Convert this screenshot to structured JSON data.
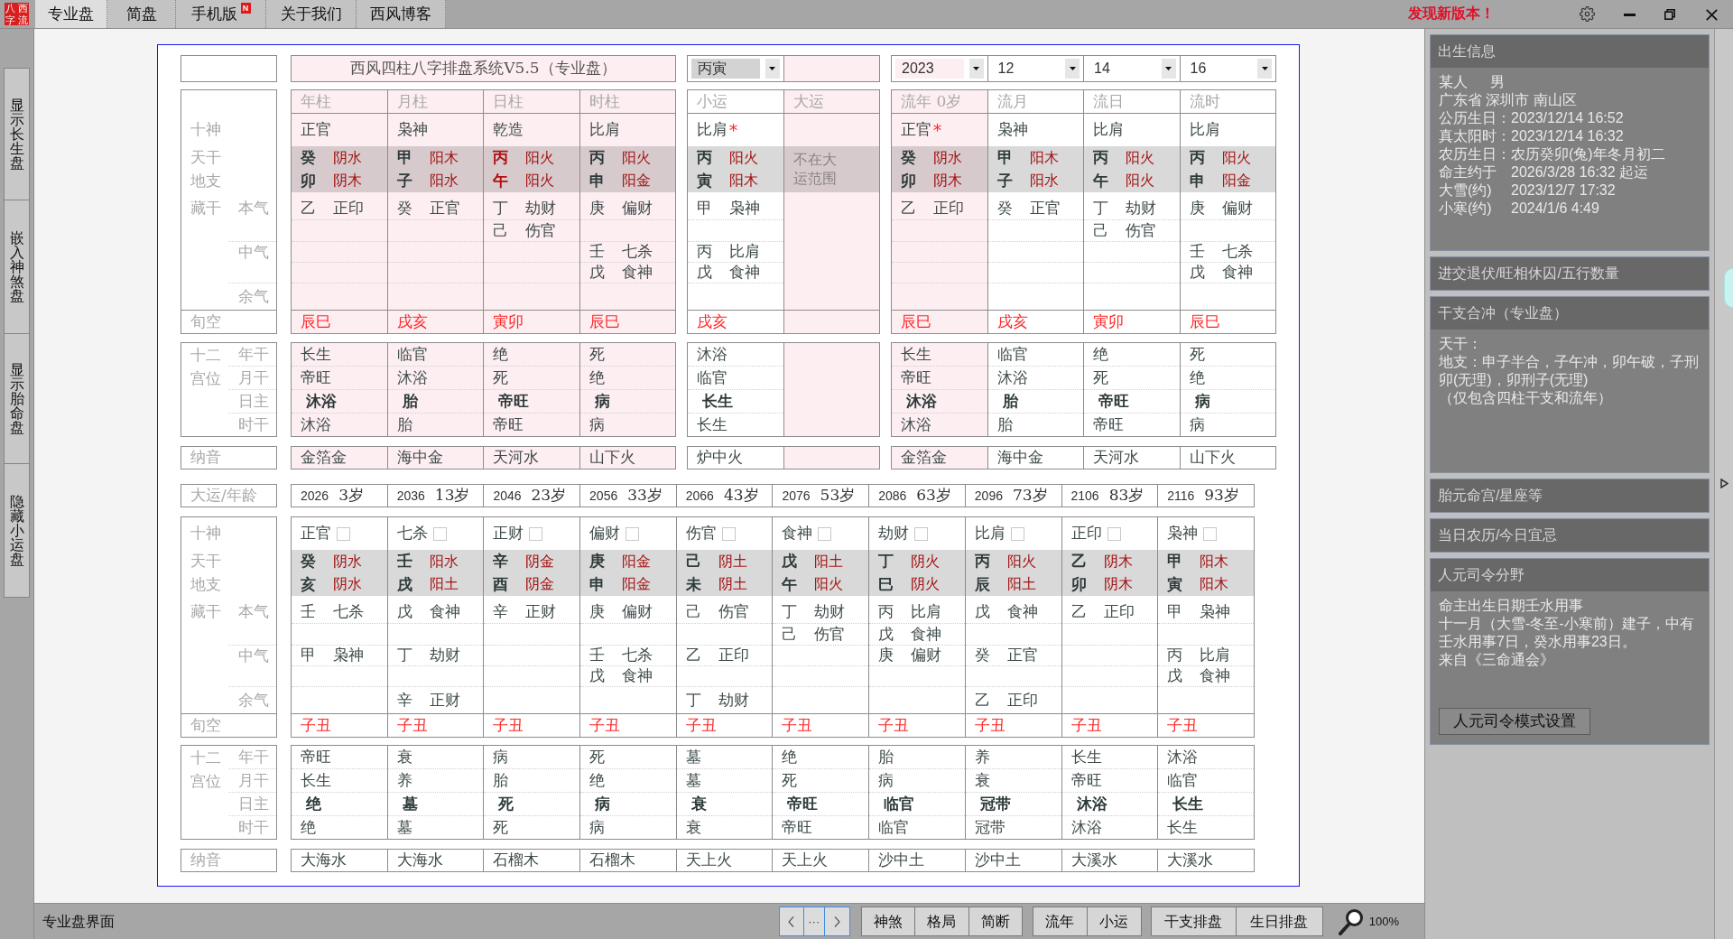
{
  "window": {
    "logo": [
      "八",
      "西",
      "字",
      "流"
    ],
    "notice": "发现新版本！"
  },
  "tabs": [
    {
      "label": "专业盘",
      "selected": true
    },
    {
      "label": "简盘",
      "selected": false
    },
    {
      "label": "手机版",
      "selected": false,
      "badge": "N"
    },
    {
      "label": "关于我们",
      "selected": false
    },
    {
      "label": "西风博客",
      "selected": false
    }
  ],
  "side_buttons": [
    "显示长生盘",
    "嵌入神煞盘",
    "显示胎命盘",
    "隐藏小运盘"
  ],
  "natal_chart": {
    "title": "西风四柱八字排盘系统V5.5（专业盘）",
    "labels": {
      "ten_god": "十神",
      "stem": "天干",
      "branch": "地支",
      "hidden": "藏干",
      "benqi": "本气",
      "zhongqi": "中气",
      "yuqi": "余气",
      "void": "旬空",
      "palace": "十二宫位",
      "palace_rows": [
        "年干",
        "月干",
        "日主",
        "时干"
      ],
      "nayin": "纳音"
    },
    "luck_controls": [
      {
        "kind": "select",
        "value": "丙寅",
        "focused": true
      },
      {
        "kind": "field"
      }
    ],
    "flow_controls": [
      {
        "kind": "select",
        "value": "2023",
        "focused": true
      },
      {
        "kind": "select",
        "value": "12",
        "focused": false
      },
      {
        "kind": "select",
        "value": "14",
        "focused": false
      },
      {
        "kind": "select",
        "value": "16",
        "focused": false
      }
    ],
    "pillars": [
      {
        "header": "年柱",
        "highlighted": true,
        "ten_god": "正官",
        "stem": "癸",
        "stem_element": "阴水",
        "branch": "卯",
        "branch_element": "阴木",
        "day_master": false,
        "hidden": {
          "benqi": [
            {
              "stem": "乙",
              "god": "正印"
            }
          ]
        },
        "void": "辰巳",
        "stages": [
          "长生",
          "帝旺",
          "沐浴",
          "沐浴"
        ],
        "nayin": "金箔金"
      },
      {
        "header": "月柱",
        "highlighted": true,
        "ten_god": "枭神",
        "stem": "甲",
        "stem_element": "阳木",
        "branch": "子",
        "branch_element": "阳水",
        "day_master": false,
        "hidden": {
          "benqi": [
            {
              "stem": "癸",
              "god": "正官"
            }
          ]
        },
        "void": "戌亥",
        "stages": [
          "临官",
          "沐浴",
          "胎",
          "胎"
        ],
        "nayin": "海中金"
      },
      {
        "header": "日柱",
        "highlighted": true,
        "ten_god": "乾造",
        "stem": "丙",
        "stem_element": "阳火",
        "branch": "午",
        "branch_element": "阳火",
        "day_master": true,
        "hidden": {
          "benqi": [
            {
              "stem": "丁",
              "god": "劫财"
            },
            {
              "stem": "己",
              "god": "伤官"
            }
          ]
        },
        "void": "寅卯",
        "stages": [
          "绝",
          "死",
          "帝旺",
          "帝旺"
        ],
        "nayin": "天河水"
      },
      {
        "header": "时柱",
        "highlighted": true,
        "ten_god": "比肩",
        "stem": "丙",
        "stem_element": "阳火",
        "branch": "申",
        "branch_element": "阳金",
        "day_master": false,
        "hidden": {
          "benqi": [
            {
              "stem": "庚",
              "god": "偏财"
            }
          ],
          "zhongqi": [
            {
              "stem": "壬",
              "god": "七杀"
            },
            {
              "stem": "戊",
              "god": "食神"
            }
          ]
        },
        "void": "辰巳",
        "stages": [
          "死",
          "绝",
          "病",
          "病"
        ],
        "nayin": "山下火"
      }
    ],
    "luck": [
      {
        "header": "小运",
        "highlighted": false,
        "ten_god": "比肩",
        "flag": "*",
        "stem": "丙",
        "stem_element": "阳火",
        "branch": "寅",
        "branch_element": "阳木",
        "day_master": false,
        "hidden": {
          "benqi": [
            {
              "stem": "甲",
              "god": "枭神"
            }
          ],
          "zhongqi": [
            {
              "stem": "丙",
              "god": "比肩"
            },
            {
              "stem": "戊",
              "god": "食神"
            }
          ]
        },
        "void": "戌亥",
        "stages": [
          "沐浴",
          "临官",
          "长生",
          "长生"
        ],
        "nayin": "炉中火"
      },
      {
        "header": "大运",
        "highlighted": true,
        "note": "不在大运范围"
      }
    ],
    "flow": [
      {
        "header": "流年 0岁",
        "highlighted": true,
        "ten_god": "正官",
        "flag": "*",
        "stem": "癸",
        "stem_element": "阴水",
        "branch": "卯",
        "branch_element": "阴木",
        "day_master": false,
        "hidden": {
          "benqi": [
            {
              "stem": "乙",
              "god": "正印"
            }
          ]
        },
        "void": "辰巳",
        "stages": [
          "长生",
          "帝旺",
          "沐浴",
          "沐浴"
        ],
        "nayin": "金箔金"
      },
      {
        "header": "流月",
        "highlighted": false,
        "ten_god": "枭神",
        "stem": "甲",
        "stem_element": "阳木",
        "branch": "子",
        "branch_element": "阳水",
        "day_master": false,
        "hidden": {
          "benqi": [
            {
              "stem": "癸",
              "god": "正官"
            }
          ]
        },
        "void": "戌亥",
        "stages": [
          "临官",
          "沐浴",
          "胎",
          "胎"
        ],
        "nayin": "海中金"
      },
      {
        "header": "流日",
        "highlighted": false,
        "ten_god": "比肩",
        "stem": "丙",
        "stem_element": "阳火",
        "branch": "午",
        "branch_element": "阳火",
        "day_master": false,
        "hidden": {
          "benqi": [
            {
              "stem": "丁",
              "god": "劫财"
            },
            {
              "stem": "己",
              "god": "伤官"
            }
          ]
        },
        "void": "寅卯",
        "stages": [
          "绝",
          "死",
          "帝旺",
          "帝旺"
        ],
        "nayin": "天河水"
      },
      {
        "header": "流时",
        "highlighted": false,
        "ten_god": "比肩",
        "stem": "丙",
        "stem_element": "阳火",
        "branch": "申",
        "branch_element": "阳金",
        "day_master": false,
        "hidden": {
          "benqi": [
            {
              "stem": "庚",
              "god": "偏财"
            }
          ],
          "zhongqi": [
            {
              "stem": "壬",
              "god": "七杀"
            },
            {
              "stem": "戊",
              "god": "食神"
            }
          ]
        },
        "void": "辰巳",
        "stages": [
          "死",
          "绝",
          "病",
          "病"
        ],
        "nayin": "山下火"
      }
    ]
  },
  "luck_chart": {
    "label": "大运/年龄",
    "labels": {
      "ten_god": "十神",
      "stem": "天干",
      "branch": "地支",
      "hidden": "藏干",
      "benqi": "本气",
      "zhongqi": "中气",
      "yuqi": "余气",
      "void": "旬空",
      "palace": "十二宫位",
      "palace_rows": [
        "年干",
        "月干",
        "日主",
        "时干"
      ],
      "nayin": "纳音"
    },
    "periods": [
      {
        "year": "2026",
        "age": "3岁",
        "ten_god": "正官",
        "checked": false,
        "stem": "癸",
        "stem_element": "阴水",
        "branch": "亥",
        "branch_element": "阴水",
        "hidden": {
          "benqi": [
            {
              "stem": "壬",
              "god": "七杀"
            }
          ],
          "zhongqi": [
            {
              "stem": "甲",
              "god": "枭神"
            }
          ]
        },
        "void": "子丑",
        "stages": [
          "帝旺",
          "长生",
          "绝",
          "绝"
        ],
        "nayin": "大海水"
      },
      {
        "year": "2036",
        "age": "13岁",
        "ten_god": "七杀",
        "checked": false,
        "stem": "壬",
        "stem_element": "阳水",
        "branch": "戌",
        "branch_element": "阳土",
        "hidden": {
          "benqi": [
            {
              "stem": "戊",
              "god": "食神"
            }
          ],
          "zhongqi": [
            {
              "stem": "丁",
              "god": "劫财"
            }
          ],
          "yuqi": [
            {
              "stem": "辛",
              "god": "正财"
            }
          ]
        },
        "void": "子丑",
        "stages": [
          "衰",
          "养",
          "墓",
          "墓"
        ],
        "nayin": "大海水"
      },
      {
        "year": "2046",
        "age": "23岁",
        "ten_god": "正财",
        "checked": false,
        "stem": "辛",
        "stem_element": "阴金",
        "branch": "酉",
        "branch_element": "阴金",
        "hidden": {
          "benqi": [
            {
              "stem": "辛",
              "god": "正财"
            }
          ]
        },
        "void": "子丑",
        "stages": [
          "病",
          "胎",
          "死",
          "死"
        ],
        "nayin": "石榴木"
      },
      {
        "year": "2056",
        "age": "33岁",
        "ten_god": "偏财",
        "checked": false,
        "stem": "庚",
        "stem_element": "阳金",
        "branch": "申",
        "branch_element": "阳金",
        "hidden": {
          "benqi": [
            {
              "stem": "庚",
              "god": "偏财"
            }
          ],
          "zhongqi": [
            {
              "stem": "壬",
              "god": "七杀"
            },
            {
              "stem": "戊",
              "god": "食神"
            }
          ]
        },
        "void": "子丑",
        "stages": [
          "死",
          "绝",
          "病",
          "病"
        ],
        "nayin": "石榴木"
      },
      {
        "year": "2066",
        "age": "43岁",
        "ten_god": "伤官",
        "checked": false,
        "stem": "己",
        "stem_element": "阴土",
        "branch": "未",
        "branch_element": "阴土",
        "hidden": {
          "benqi": [
            {
              "stem": "己",
              "god": "伤官"
            }
          ],
          "zhongqi": [
            {
              "stem": "乙",
              "god": "正印"
            }
          ],
          "yuqi": [
            {
              "stem": "丁",
              "god": "劫财"
            }
          ]
        },
        "void": "子丑",
        "stages": [
          "墓",
          "墓",
          "衰",
          "衰"
        ],
        "nayin": "天上火"
      },
      {
        "year": "2076",
        "age": "53岁",
        "ten_god": "食神",
        "checked": false,
        "stem": "戊",
        "stem_element": "阳土",
        "branch": "午",
        "branch_element": "阳火",
        "hidden": {
          "benqi": [
            {
              "stem": "丁",
              "god": "劫财"
            },
            {
              "stem": "己",
              "god": "伤官"
            }
          ]
        },
        "void": "子丑",
        "stages": [
          "绝",
          "死",
          "帝旺",
          "帝旺"
        ],
        "nayin": "天上火"
      },
      {
        "year": "2086",
        "age": "63岁",
        "ten_god": "劫财",
        "checked": false,
        "stem": "丁",
        "stem_element": "阴火",
        "branch": "巳",
        "branch_element": "阴火",
        "hidden": {
          "benqi": [
            {
              "stem": "丙",
              "god": "比肩"
            },
            {
              "stem": "戊",
              "god": "食神"
            }
          ],
          "zhongqi": [
            {
              "stem": "庚",
              "god": "偏财"
            }
          ]
        },
        "void": "子丑",
        "stages": [
          "胎",
          "病",
          "临官",
          "临官"
        ],
        "nayin": "沙中土"
      },
      {
        "year": "2096",
        "age": "73岁",
        "ten_god": "比肩",
        "checked": false,
        "stem": "丙",
        "stem_element": "阳火",
        "branch": "辰",
        "branch_element": "阳土",
        "hidden": {
          "benqi": [
            {
              "stem": "戊",
              "god": "食神"
            }
          ],
          "zhongqi": [
            {
              "stem": "癸",
              "god": "正官"
            }
          ],
          "yuqi": [
            {
              "stem": "乙",
              "god": "正印"
            }
          ]
        },
        "void": "子丑",
        "stages": [
          "养",
          "衰",
          "冠带",
          "冠带"
        ],
        "nayin": "沙中土"
      },
      {
        "year": "2106",
        "age": "83岁",
        "ten_god": "正印",
        "checked": false,
        "stem": "乙",
        "stem_element": "阴木",
        "branch": "卯",
        "branch_element": "阴木",
        "hidden": {
          "benqi": [
            {
              "stem": "乙",
              "god": "正印"
            }
          ]
        },
        "void": "子丑",
        "stages": [
          "长生",
          "帝旺",
          "沐浴",
          "沐浴"
        ],
        "nayin": "大溪水"
      },
      {
        "year": "2116",
        "age": "93岁",
        "ten_god": "枭神",
        "checked": false,
        "stem": "甲",
        "stem_element": "阳木",
        "branch": "寅",
        "branch_element": "阳木",
        "hidden": {
          "benqi": [
            {
              "stem": "甲",
              "god": "枭神"
            }
          ],
          "zhongqi": [
            {
              "stem": "丙",
              "god": "比肩"
            },
            {
              "stem": "戊",
              "god": "食神"
            }
          ]
        },
        "void": "子丑",
        "stages": [
          "沐浴",
          "临官",
          "长生",
          "长生"
        ],
        "nayin": "大溪水"
      }
    ]
  },
  "info_panels": [
    {
      "title": "出生信息",
      "expanded": true,
      "kind": "birth",
      "person": {
        "name": "某人",
        "gender": "男"
      },
      "lines": [
        "广东省 深圳市 南山区"
      ],
      "rows": [
        {
          "label": "公历生日：",
          "value": "2023/12/14 16:52"
        },
        {
          "label": "真太阳时：",
          "value": "2023/12/14 16:32"
        },
        {
          "label": "农历生日：",
          "value": "农历癸卯(兔)年冬月初二"
        },
        {
          "label": "命主约于",
          "value": "2026/3/28 16:32 起运"
        },
        {
          "label": "大雪(约)",
          "value": "2023/12/7 17:32"
        },
        {
          "label": "小寒(约)",
          "value": "2024/1/6 4:49"
        }
      ]
    },
    {
      "title": "进交退伏/旺相休囚/五行数量",
      "expanded": false
    },
    {
      "title": "干支合冲（专业盘）",
      "expanded": true,
      "kind": "text",
      "lines": [
        "天干：",
        "地支：申子半合，子午冲，卯午破，子刑卯(无理)，卯刑子(无理)",
        "（仅包含四柱干支和流年）"
      ]
    },
    {
      "title": "胎元命宫/星座等",
      "expanded": false
    },
    {
      "title": "当日农历/今日宜忌",
      "expanded": false
    },
    {
      "title": "人元司令分野",
      "expanded": true,
      "kind": "text",
      "lines": [
        "命主出生日期壬水用事",
        "十一月（大雪-冬至-小寒前）建子，中有壬水用事7日，癸水用事23日。",
        "来自《三命通会》"
      ],
      "button": "人元司令模式设置"
    }
  ],
  "status_bar": {
    "text": "专业盘界面",
    "pager_more": "···",
    "button_groups": [
      [
        "神煞",
        "格局",
        "简断"
      ],
      [
        "流年",
        "小运"
      ],
      [
        "干支排盘",
        "生日排盘"
      ]
    ],
    "zoom": "100%"
  }
}
